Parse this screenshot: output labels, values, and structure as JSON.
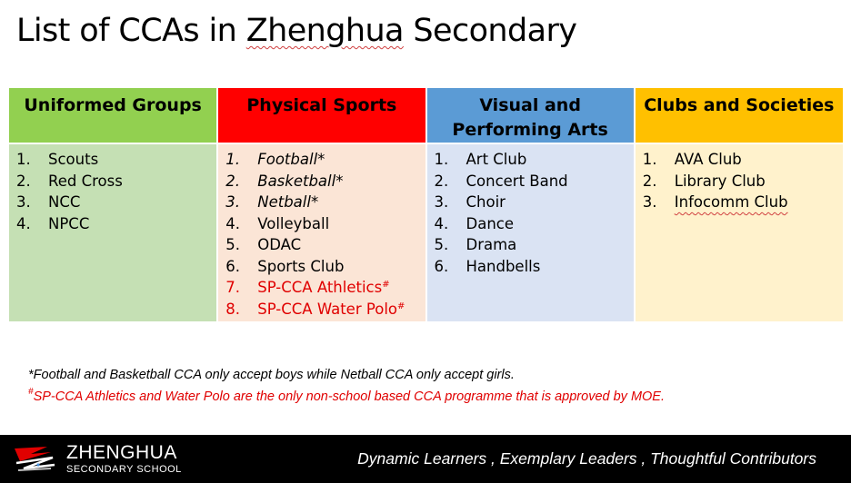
{
  "title": {
    "prefix": "List of CCAs in ",
    "school": "Zhenghua",
    "suffix": " Secondary"
  },
  "columns": [
    {
      "header": "Uniformed Groups",
      "items": [
        {
          "num": "1.",
          "label": "Scouts"
        },
        {
          "num": "2.",
          "label": "Red Cross"
        },
        {
          "num": "3.",
          "label": "NCC"
        },
        {
          "num": "4.",
          "label": "NPCC"
        }
      ]
    },
    {
      "header": "Physical Sports",
      "items": [
        {
          "num": "1.",
          "label": "Football*"
        },
        {
          "num": "2.",
          "label": "Basketball*"
        },
        {
          "num": "3.",
          "label": "Netball*"
        },
        {
          "num": "4.",
          "label": "Volleyball"
        },
        {
          "num": "5.",
          "label": "ODAC"
        },
        {
          "num": "6.",
          "label": "Sports Club"
        },
        {
          "num": "7.",
          "label": "SP-CCA Athletics",
          "mark": "#"
        },
        {
          "num": "8.",
          "label": "SP-CCA Water Polo",
          "mark": "#"
        }
      ]
    },
    {
      "header": "Visual and Performing Arts",
      "items": [
        {
          "num": "1.",
          "label": "Art Club"
        },
        {
          "num": "2.",
          "label": "Concert Band"
        },
        {
          "num": "3.",
          "label": "Choir"
        },
        {
          "num": "4.",
          "label": "Dance"
        },
        {
          "num": "5.",
          "label": "Drama"
        },
        {
          "num": "6.",
          "label": "Handbells"
        }
      ]
    },
    {
      "header": "Clubs and Societies",
      "items": [
        {
          "num": "1.",
          "label": "AVA Club"
        },
        {
          "num": "2.",
          "label": "Library Club"
        },
        {
          "num": "3.",
          "label": "Infocomm Club"
        }
      ]
    }
  ],
  "notes": {
    "note1": "*Football and Basketball CCA only accept boys while Netball CCA only accept girls.",
    "note2_mark": "#",
    "note2": "SP-CCA Athletics and Water Polo are the only non-school based CCA programme that is approved by MOE."
  },
  "footer": {
    "school_name": "ZHENGHUA",
    "school_sub": "SECONDARY SCHOOL",
    "tagline": "Dynamic Learners , Exemplary Leaders , Thoughtful Contributors"
  },
  "colors": {
    "uniformed_header": "#92d050",
    "sports_header": "#ff0000",
    "arts_header": "#5b9bd5",
    "clubs_header": "#ffc000",
    "note_red": "#e00000"
  }
}
